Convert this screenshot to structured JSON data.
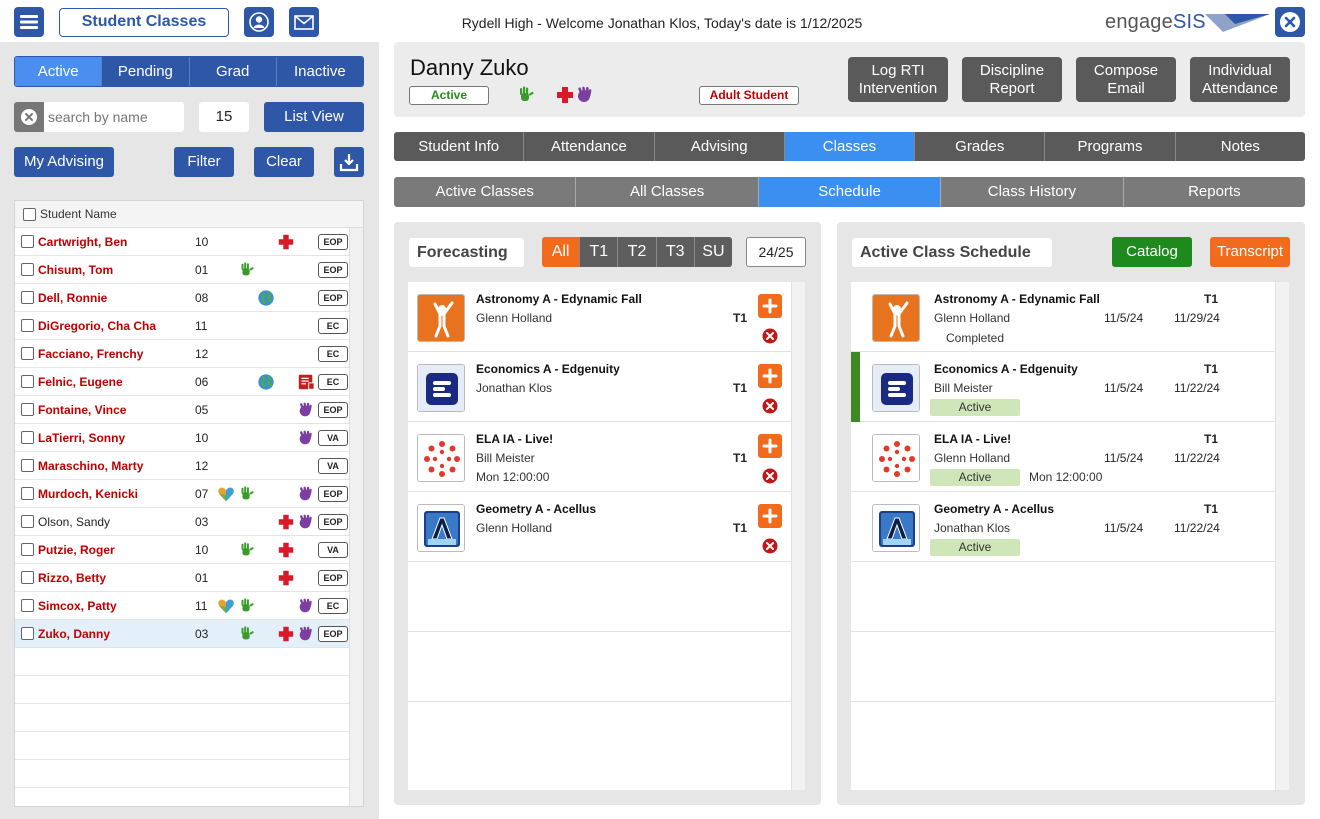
{
  "app": {
    "title": "Student Classes",
    "welcome": "Rydell High - Welcome Jonathan Klos, Today's date is 1/12/2025",
    "logo_main": "engage",
    "logo_accent": "SIS"
  },
  "left": {
    "status_tabs": [
      "Active",
      "Pending",
      "Grad",
      "Inactive"
    ],
    "active_tab": "Active",
    "search_placeholder": "search by name",
    "page_size": "15",
    "list_view_label": "List View",
    "my_advising_label": "My Advising",
    "filter_label": "Filter",
    "clear_label": "Clear",
    "column_header": "Student Name"
  },
  "students": [
    {
      "name": "Cartwright, Ben",
      "grade": "10",
      "program": "EOP",
      "icons": [
        "medical-icon"
      ]
    },
    {
      "name": "Chisum, Tom",
      "grade": "01",
      "program": "EOP",
      "icons": [
        "hand-green-icon"
      ]
    },
    {
      "name": "Dell, Ronnie",
      "grade": "08",
      "program": "EOP",
      "icons": [
        "globe-icon"
      ]
    },
    {
      "name": "DiGregorio, Cha Cha",
      "grade": "11",
      "program": "EC",
      "icons": []
    },
    {
      "name": "Facciano, Frenchy",
      "grade": "12",
      "program": "EC",
      "icons": []
    },
    {
      "name": "Felnic, Eugene",
      "grade": "06",
      "program": "EC",
      "icons": [
        "globe-icon",
        "book-icon"
      ]
    },
    {
      "name": "Fontaine, Vince",
      "grade": "05",
      "program": "EOP",
      "icons": [
        "hand-purple-icon"
      ]
    },
    {
      "name": "LaTierri, Sonny",
      "grade": "10",
      "program": "VA",
      "icons": [
        "hand-purple-icon"
      ]
    },
    {
      "name": "Maraschino, Marty",
      "grade": "12",
      "program": "VA",
      "icons": []
    },
    {
      "name": "Murdoch, Kenicki",
      "grade": "07",
      "program": "EOP",
      "icons": [
        "heart-icon",
        "hand-green-icon",
        "hand-purple-icon"
      ]
    },
    {
      "name": "Olson, Sandy",
      "grade": "03",
      "program": "EOP",
      "icons": [
        "medical-icon",
        "hand-purple-icon"
      ]
    },
    {
      "name": "Putzie, Roger",
      "grade": "10",
      "program": "VA",
      "icons": [
        "hand-green-icon",
        "medical-icon"
      ]
    },
    {
      "name": "Rizzo, Betty",
      "grade": "01",
      "program": "EOP",
      "icons": [
        "medical-icon"
      ]
    },
    {
      "name": "Simcox, Patty",
      "grade": "11",
      "program": "EC",
      "icons": [
        "heart-icon",
        "hand-green-icon",
        "hand-purple-icon"
      ]
    },
    {
      "name": "Zuko, Danny",
      "grade": "03",
      "program": "EOP",
      "icons": [
        "hand-green-icon",
        "medical-icon",
        "hand-purple-icon"
      ]
    }
  ],
  "student": {
    "name": "Danny Zuko",
    "status": "Active",
    "flag": "Adult Student",
    "actions": [
      {
        "line1": "Log RTI",
        "line2": "Intervention"
      },
      {
        "line1": "Discipline",
        "line2": "Report"
      },
      {
        "line1": "Compose",
        "line2": "Email"
      },
      {
        "line1": "Individual",
        "line2": "Attendance"
      }
    ]
  },
  "main_tabs": [
    "Student Info",
    "Attendance",
    "Advising",
    "Classes",
    "Grades",
    "Programs",
    "Notes"
  ],
  "main_tab_active": "Classes",
  "sub_tabs": [
    "Active Classes",
    "All Classes",
    "Schedule",
    "Class History",
    "Reports"
  ],
  "sub_tab_active": "Schedule",
  "forecasting": {
    "title": "Forecasting",
    "terms": [
      "All",
      "T1",
      "T2",
      "T3",
      "SU"
    ],
    "active_term": "All",
    "year": "24/25",
    "classes": [
      {
        "title": "Astronomy A - Edynamic Fall",
        "teacher": "Glenn Holland",
        "term": "T1",
        "extra": "",
        "logo": "edynamic-logo"
      },
      {
        "title": "Economics A - Edgenuity",
        "teacher": "Jonathan Klos",
        "term": "T1",
        "extra": "",
        "logo": "edgenuity-logo"
      },
      {
        "title": "ELA IA - Live!",
        "teacher": "Bill Meister",
        "term": "T1",
        "extra": "Mon 12:00:00",
        "logo": "live-logo"
      },
      {
        "title": "Geometry A - Acellus",
        "teacher": "Glenn Holland",
        "term": "T1",
        "extra": "",
        "logo": "acellus-logo"
      }
    ]
  },
  "schedule": {
    "title": "Active Class Schedule",
    "catalog_label": "Catalog",
    "transcript_label": "Transcript",
    "classes": [
      {
        "title": "Astronomy A - Edynamic Fall",
        "teacher": "Glenn Holland",
        "term": "T1",
        "start": "11/5/24",
        "end": "11/29/24",
        "status": "Completed",
        "time": "",
        "logo": "edynamic-logo"
      },
      {
        "title": "Economics A - Edgenuity",
        "teacher": "Bill Meister",
        "term": "T1",
        "start": "11/5/24",
        "end": "11/22/24",
        "status": "Active",
        "time": "",
        "logo": "edgenuity-logo"
      },
      {
        "title": "ELA IA - Live!",
        "teacher": "Glenn Holland",
        "term": "T1",
        "start": "11/5/24",
        "end": "11/22/24",
        "status": "Active",
        "time": "Mon 12:00:00",
        "logo": "live-logo"
      },
      {
        "title": "Geometry A - Acellus",
        "teacher": "Jonathan Klos",
        "term": "T1",
        "start": "11/5/24",
        "end": "11/22/24",
        "status": "Active",
        "time": "",
        "logo": "acellus-logo"
      }
    ]
  },
  "colors": {
    "brand_blue": "#2e57a8",
    "active_blue": "#3b8ff0",
    "orange": "#f26b1d",
    "green": "#1e8a1e",
    "alert_red": "#c00000"
  }
}
